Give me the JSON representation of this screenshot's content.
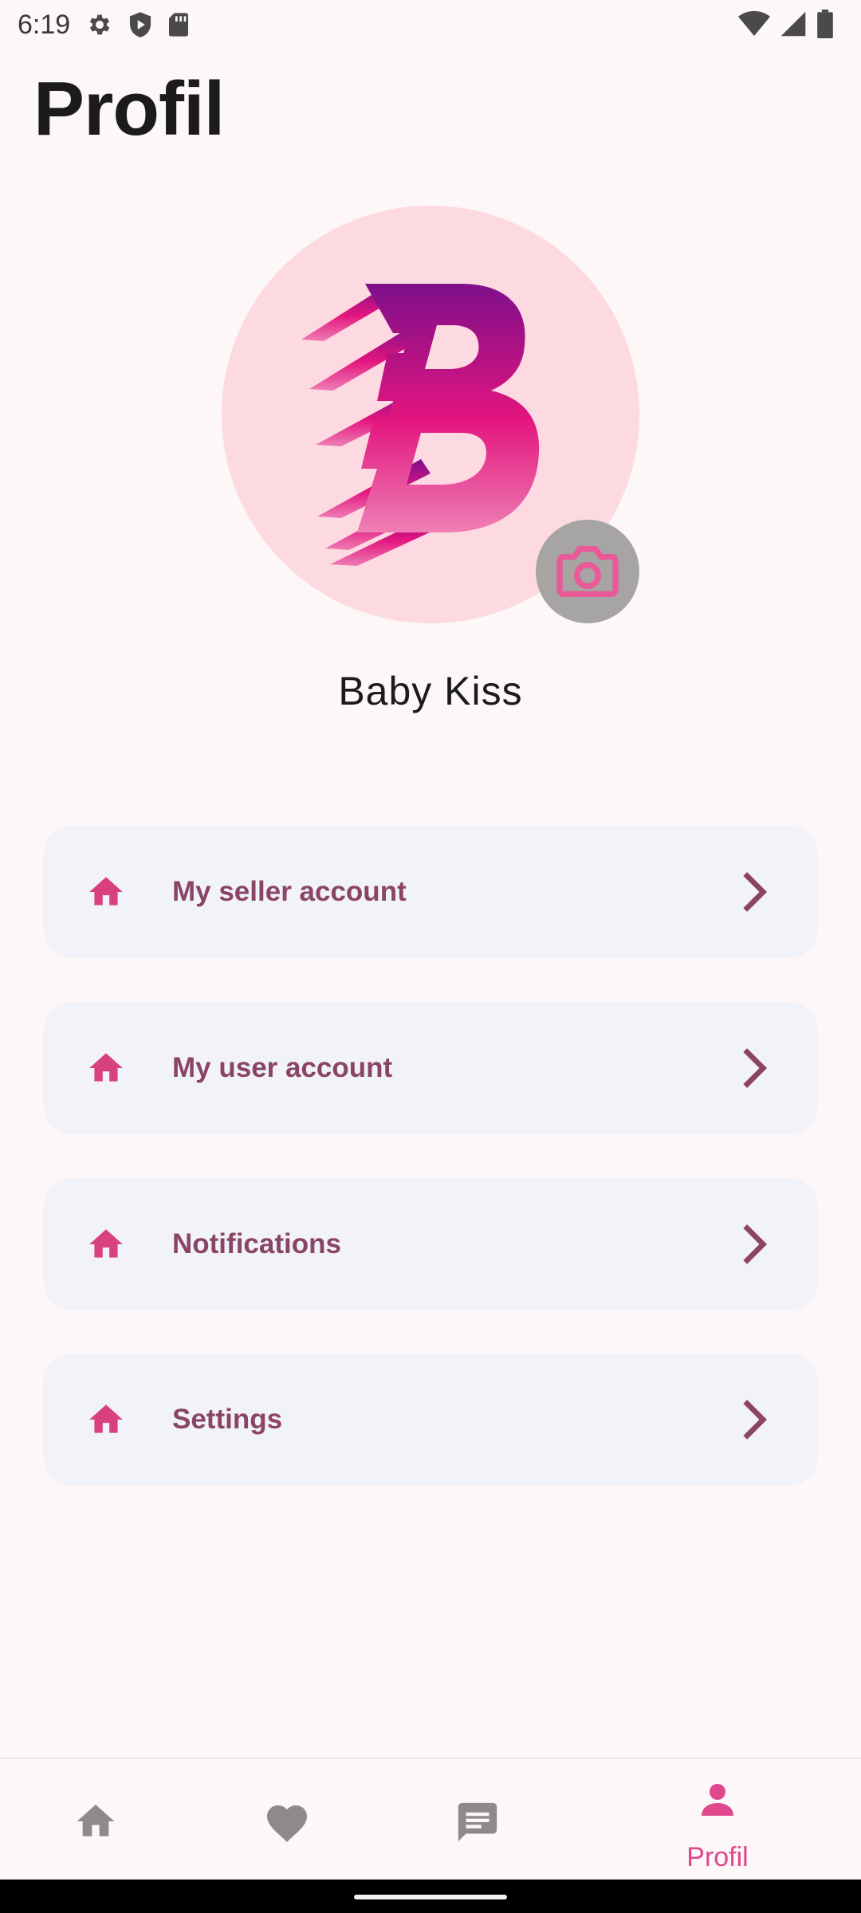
{
  "status_bar": {
    "time": "6:19",
    "icons_left": [
      "gear-icon",
      "shield-play-icon",
      "sd-card-icon"
    ],
    "icons_right": [
      "wifi-icon",
      "signal-icon",
      "battery-icon"
    ]
  },
  "page": {
    "title": "Profil"
  },
  "profile": {
    "name": "Baby Kiss",
    "avatar_logo": "B",
    "camera_icon": "camera-icon"
  },
  "menu": [
    {
      "label": "My seller account",
      "icon": "home-icon"
    },
    {
      "label": "My user account",
      "icon": "home-icon"
    },
    {
      "label": "Notifications",
      "icon": "home-icon"
    },
    {
      "label": "Settings",
      "icon": "home-icon"
    }
  ],
  "bottom_nav": {
    "items": [
      {
        "icon": "home-icon",
        "label": ""
      },
      {
        "icon": "heart-icon",
        "label": ""
      },
      {
        "icon": "chat-icon",
        "label": ""
      },
      {
        "icon": "person-icon",
        "label": "Profil",
        "active": true
      }
    ]
  },
  "colors": {
    "accent": "#e0478d",
    "menu_text": "#8a4466",
    "card_bg": "#f2f3f8",
    "avatar_bg": "#fdd9e2",
    "nav_inactive": "#8e8a8b"
  }
}
